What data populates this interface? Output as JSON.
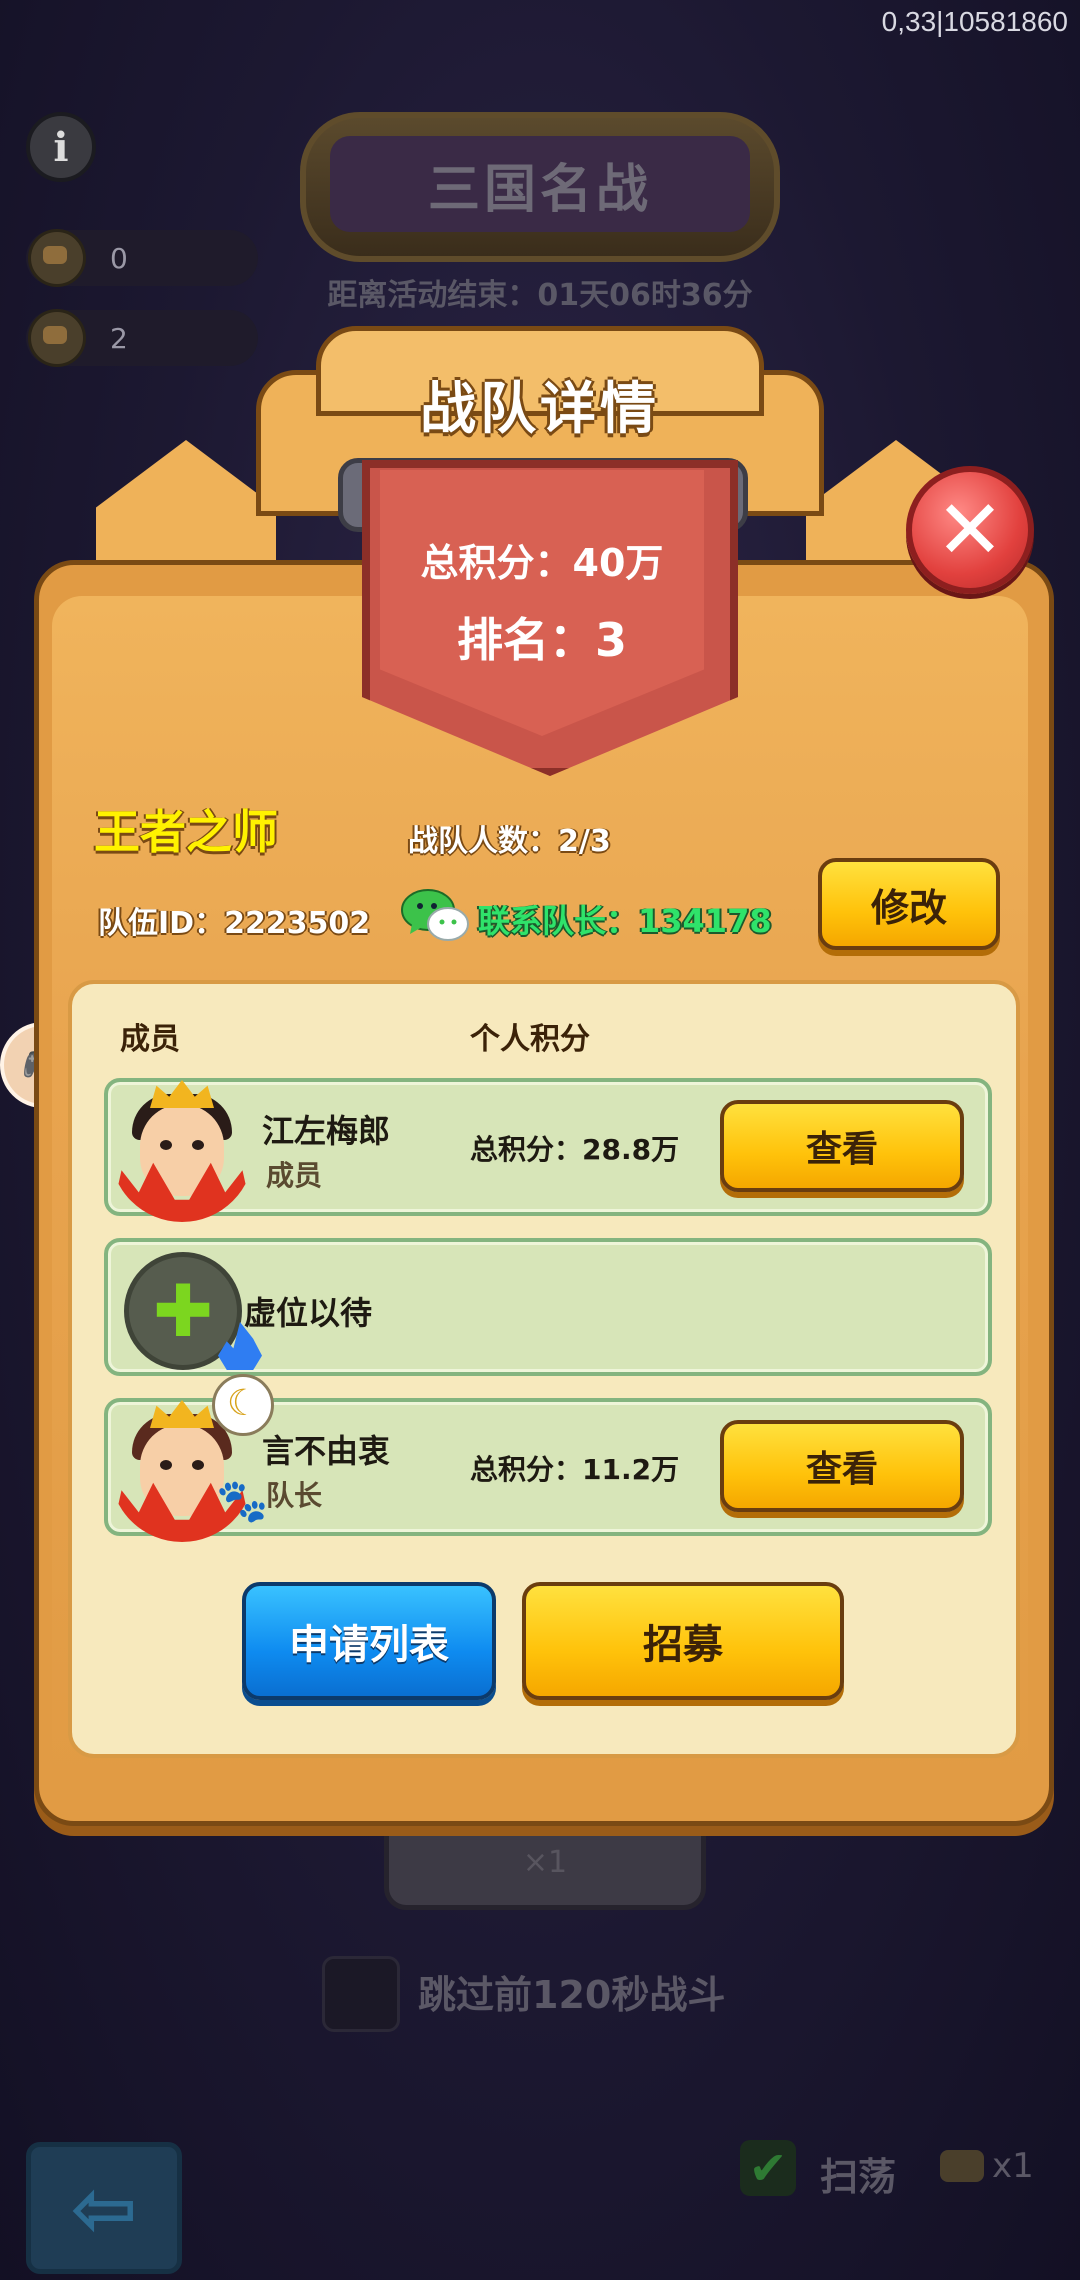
{
  "debug": "0,33|10581860",
  "background": {
    "info_icon": "i",
    "resources": [
      {
        "icon": "drumstick-ticket-icon",
        "value": "0"
      },
      {
        "icon": "scroll-ticket-icon",
        "value": "2"
      }
    ],
    "event_title": "三国名战",
    "countdown": "距离活动结束：01天06时36分",
    "battle_cost": "×1",
    "skip_text": "跳过前120秒战斗",
    "sweep_label": "扫荡",
    "sweep_cost": "x1"
  },
  "dialog": {
    "title": "战队详情",
    "total_score": "总积分：40万",
    "rank": "排名：3",
    "team_name": "王者之师",
    "member_count": "战队人数：2/3",
    "team_id": "队伍ID：2223502",
    "contact_captain": "联系队长：134178",
    "edit_label": "修改",
    "columns": {
      "member": "成员",
      "score": "个人积分"
    },
    "members": [
      {
        "name": "江左梅郎",
        "role": "成员",
        "score": "总积分：28.8万",
        "button": "查看"
      },
      {
        "placeholder": "虚位以待"
      },
      {
        "name": "言不由衷",
        "role": "队长",
        "score": "总积分：11.2万",
        "button": "查看"
      }
    ],
    "apply_list_label": "申请列表",
    "recruit_label": "招募"
  },
  "colors": {
    "dialog_bg": "#e19b44",
    "panel_bg": "#f7e9bd",
    "row_bg": "#d7e5b8",
    "team_name": "#fff200",
    "contact_green": "#2fe36a",
    "scroll_red": "#d86153"
  }
}
